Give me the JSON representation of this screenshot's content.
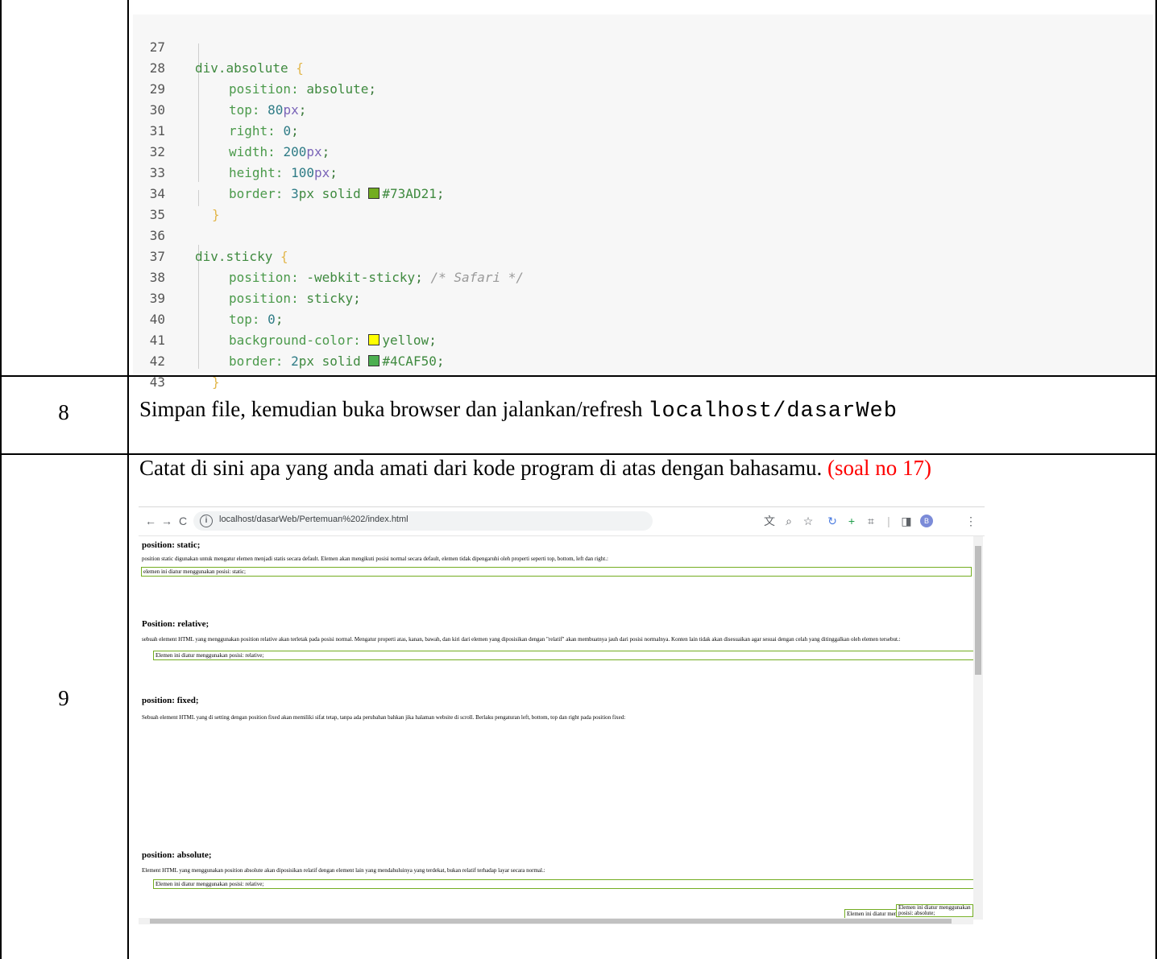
{
  "rows": {
    "row8_num": "8",
    "row8_text_lead": "Simpan file, kemudian buka browser dan jalankan/refresh ",
    "row8_code": "localhost/dasarWeb",
    "row9_num": "9",
    "row9_text": "Catat di sini apa yang anda amati dari kode program di atas dengan bahasamu. ",
    "row9_red": "(soal no 17)"
  },
  "code": {
    "line_numbers": [
      "27",
      "28",
      "29",
      "30",
      "31",
      "32",
      "33",
      "34",
      "35",
      "36",
      "37",
      "38",
      "39",
      "40",
      "41",
      "42",
      "43"
    ],
    "l27_sel": "div.absolute",
    "l28_prop": "position: ",
    "l28_val": "absolute",
    "l29_prop": "top: ",
    "l29_num": "80",
    "l29_unit": "px",
    "l30_prop": "right: ",
    "l30_num": "0",
    "l31_prop": "width: ",
    "l31_num": "200",
    "l31_unit": "px",
    "l32_prop": "height: ",
    "l32_num": "100",
    "l32_unit": "px",
    "l33_prop": "border: ",
    "l33_num": "3",
    "l33_val": "px solid ",
    "l33_color": "#73AD21",
    "l36_sel": "div.sticky",
    "l37_prop": "position: ",
    "l37_val": "-webkit-sticky",
    "l37_cmt": "/* Safari */",
    "l38_prop": "position: ",
    "l38_val": "sticky",
    "l39_prop": "top: ",
    "l39_num": "0",
    "l40_prop": "background-color: ",
    "l40_color": "yellow",
    "l41_prop": "border: ",
    "l41_num": "2",
    "l41_val": "px solid ",
    "l41_color": "#4CAF50",
    "brace_open": "{",
    "brace_close": "}",
    "semicolon": ";",
    "swatch_colors": [
      "#73AD21",
      "#ffff00",
      "#4CAF50"
    ]
  },
  "browser": {
    "url": "localhost/dasarWeb/Pertemuan%202/index.html",
    "nav_back": "←",
    "nav_forward": "→",
    "nav_reload": "C",
    "info": "i",
    "profile_initial": "B",
    "page": {
      "static_heading": "position: static;",
      "static_desc": "position static digunakan untuk mengatur elemen menjadi statis secara default. Elemen akan mengikuti posisi normal secara default, elemen tidak dipengaruhi oleh properti seperti top, bottom, left dan right.:",
      "static_box": "elemen ini diatur menggunakan posisi: static;",
      "relative_heading": "Position: relative;",
      "relative_desc": "sebuah element HTML yang menggunakan position relative akan terletak pada posisi normal. Mengatur properti atas, kanan, bawah, dan kiri dari elemen yang diposisikan dengan \"relatif\" akan membuatnya jauh dari posisi normalnya. Konten lain tidak akan disesuaikan agar sesuai dengan celah yang ditinggalkan oleh elemen tersebut.:",
      "relative_box": "Elemen ini diatur menggunakan posisi: relative;",
      "fixed_heading": "position: fixed;",
      "fixed_desc": "Sebuah element HTML yang di setting dengan position fixed akan memiliki sifat tetap, tanpa ada perubahan bahkan jika halaman website di scroll. Berlaku pengaturan left, bottom, top dan right pada position fixed:",
      "absolute_heading": "position: absolute;",
      "absolute_desc": "Element HTML yang menggunakan position absolute akan diposisikan relatif dengan element lain yang mendahuluinya yang terdekat, bukan relatif terhadap layar secara normal.:",
      "absolute_box": "Elemen ini diatur menggunakan posisi: relative;",
      "fixed_box": "Elemen ini diatur menggunakan posisi: fixed;",
      "absolute_inner": "Elemen ini diatur menggunakan posisi: absolute;"
    }
  }
}
